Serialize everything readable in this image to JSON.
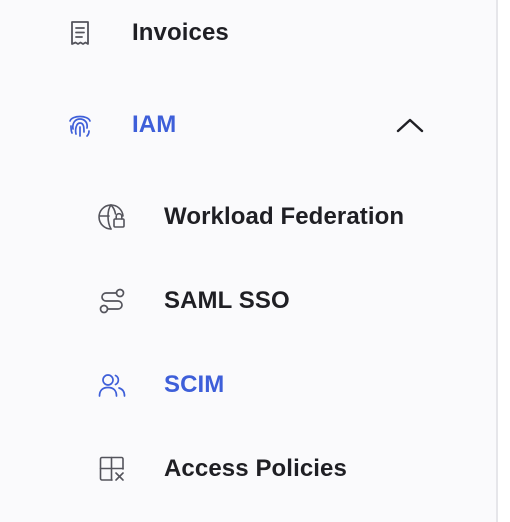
{
  "sidebar": {
    "items": [
      {
        "label": "Invoices",
        "icon": "receipt-icon"
      },
      {
        "label": "IAM",
        "icon": "fingerprint-icon",
        "expanded": true
      },
      {
        "label": "Workload Federation",
        "icon": "globe-lock-icon"
      },
      {
        "label": "SAML SSO",
        "icon": "route-icon"
      },
      {
        "label": "SCIM",
        "icon": "users-icon"
      },
      {
        "label": "Access Policies",
        "icon": "grid-x-icon"
      }
    ]
  },
  "colors": {
    "text": "#1f1f24",
    "accent": "#3e5fd9",
    "icon_gray": "#54545c",
    "background": "#fafafc"
  }
}
